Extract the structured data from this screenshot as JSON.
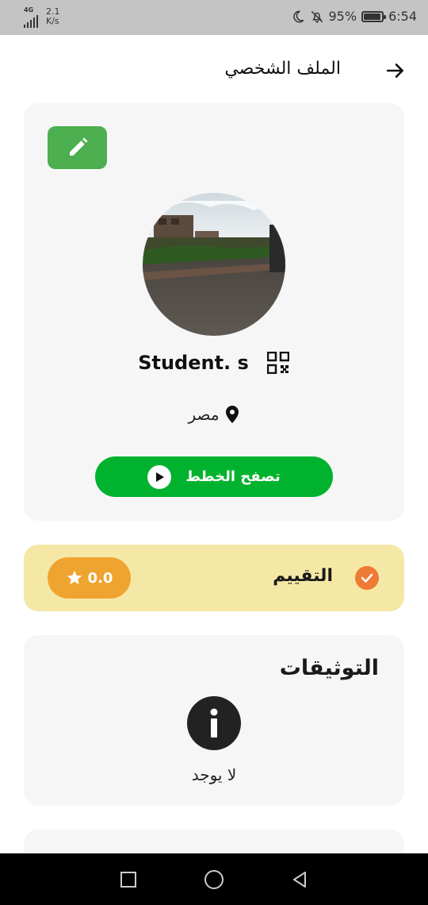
{
  "status_bar": {
    "network_type": "4G",
    "speed_value": "2.1",
    "speed_unit": "K/s",
    "battery_percent": "95%",
    "battery_level": 0.95,
    "time": "6:54",
    "icons": [
      "moon-icon",
      "bell-off-icon",
      "battery-icon"
    ]
  },
  "header": {
    "title": "الملف الشخصي",
    "back_icon": "arrow-right-icon"
  },
  "profile": {
    "edit_icon": "pencil-icon",
    "name": "Student. s",
    "qr_icon": "qr-code-icon",
    "location": "مصر",
    "location_icon": "map-pin-icon",
    "browse_button": "تصفح الخطط",
    "browse_icon": "play-icon"
  },
  "rating": {
    "label": "التقييم",
    "value": "0.0",
    "check_icon": "check-circle-icon",
    "star_icon": "star-icon"
  },
  "documents": {
    "title": "التوثيقات",
    "empty_text": "لا يوجد",
    "info_icon": "info-icon"
  },
  "colors": {
    "accent_green": "#00b22d",
    "edit_green": "#4caf50",
    "rating_bg": "#f5e8a6",
    "rating_badge": "#efa430",
    "check_orange": "#ef7a35",
    "card_bg": "#f6f6f6"
  }
}
